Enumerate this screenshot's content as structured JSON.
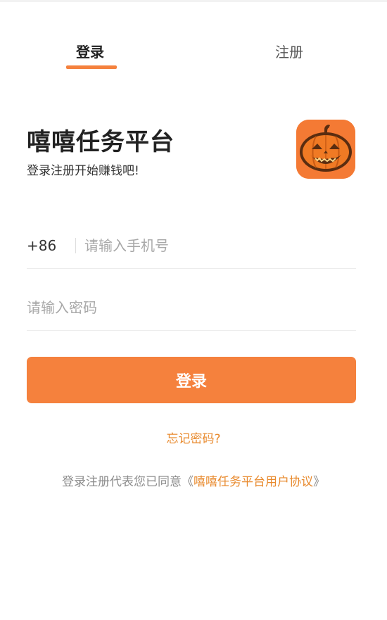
{
  "tabs": {
    "login_label": "登录",
    "register_label": "注册",
    "active": "login"
  },
  "brand": {
    "title": "嘻嘻任务平台",
    "subtitle": "登录注册开始赚钱吧!",
    "logo_icon": "pumpkin-icon"
  },
  "form": {
    "phone_prefix": "+86",
    "phone_placeholder": "请输入手机号",
    "password_placeholder": "请输入密码",
    "submit_label": "登录"
  },
  "forgot_label": "忘记密码?",
  "agreement": {
    "prefix": "登录注册代表您已同意",
    "open_bracket": "《",
    "link_text": "嘻嘻任务平台用户协议",
    "close_bracket": "》"
  },
  "colors": {
    "accent": "#f5813d",
    "link": "#e8892c"
  }
}
